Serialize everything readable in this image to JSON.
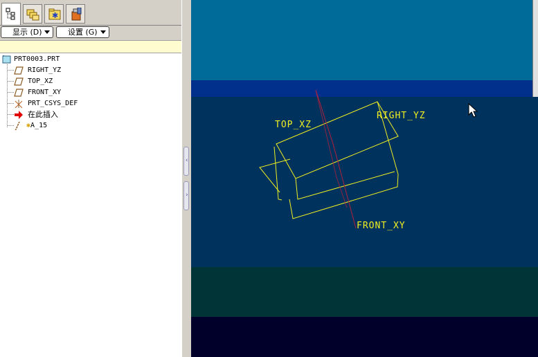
{
  "navigator": {
    "tabs": [
      {
        "name": "model-tree-tab",
        "icon": "model-tree-icon",
        "active": true
      },
      {
        "name": "folder-browser-tab",
        "icon": "folder-browser-icon",
        "active": false
      },
      {
        "name": "favorites-tab",
        "icon": "favorites-icon",
        "active": false
      },
      {
        "name": "connections-tab",
        "icon": "connections-icon",
        "active": false
      }
    ],
    "toolbar": {
      "show_label": "显示 (D)",
      "settings_label": "设置 (G)"
    },
    "tree": {
      "root": {
        "label": "PRT0003.PRT",
        "icon": "part-icon"
      },
      "items": [
        {
          "label": "RIGHT_YZ",
          "icon": "datum-plane-icon"
        },
        {
          "label": "TOP_XZ",
          "icon": "datum-plane-icon"
        },
        {
          "label": "FRONT_XY",
          "icon": "datum-plane-icon"
        },
        {
          "label": "PRT_CSYS_DEF",
          "icon": "coordinate-system-icon"
        },
        {
          "label": "在此插入",
          "icon": "insert-here-arrow-icon"
        },
        {
          "label": "A_15",
          "icon": "datum-axis-icon"
        }
      ]
    }
  },
  "viewport": {
    "datum_labels": {
      "top": "TOP_XZ",
      "right": "RIGHT_YZ",
      "front": "FRONT_XY"
    },
    "colors": {
      "datum_plane": "#f0f020",
      "datum_axis": "#b0203c",
      "band_top": "#006a98",
      "band_blue": "#00308c",
      "band_mid": "#00325e",
      "band_teal": "#003436",
      "band_bottom": "#00002a"
    }
  }
}
